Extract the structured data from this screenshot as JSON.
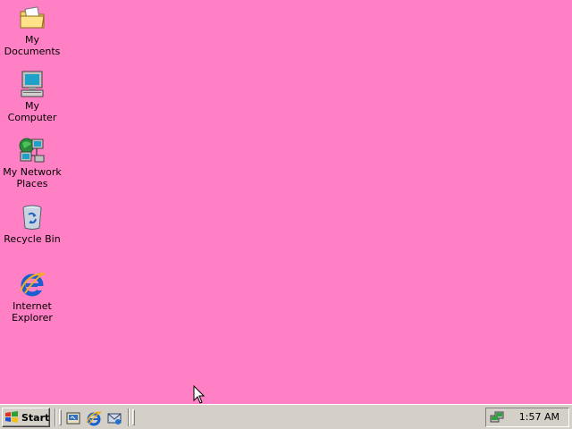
{
  "desktop": {
    "background_color": "#ff80c4",
    "icons": [
      {
        "label_line1": "My Documents",
        "label_line2": "",
        "icon": "folder-documents-icon"
      },
      {
        "label_line1": "My Computer",
        "label_line2": "",
        "icon": "computer-icon"
      },
      {
        "label_line1": "My Network",
        "label_line2": "Places",
        "icon": "network-places-icon"
      },
      {
        "label_line1": "Recycle Bin",
        "label_line2": "",
        "icon": "recycle-bin-icon"
      },
      {
        "label_line1": "Internet",
        "label_line2": "Explorer",
        "icon": "internet-explorer-icon"
      }
    ]
  },
  "taskbar": {
    "start_label": "Start",
    "quick_launch": [
      "show-desktop-icon",
      "internet-explorer-icon",
      "outlook-express-icon"
    ],
    "tray_icon": "network-tray-icon",
    "clock": "1:57 AM"
  }
}
